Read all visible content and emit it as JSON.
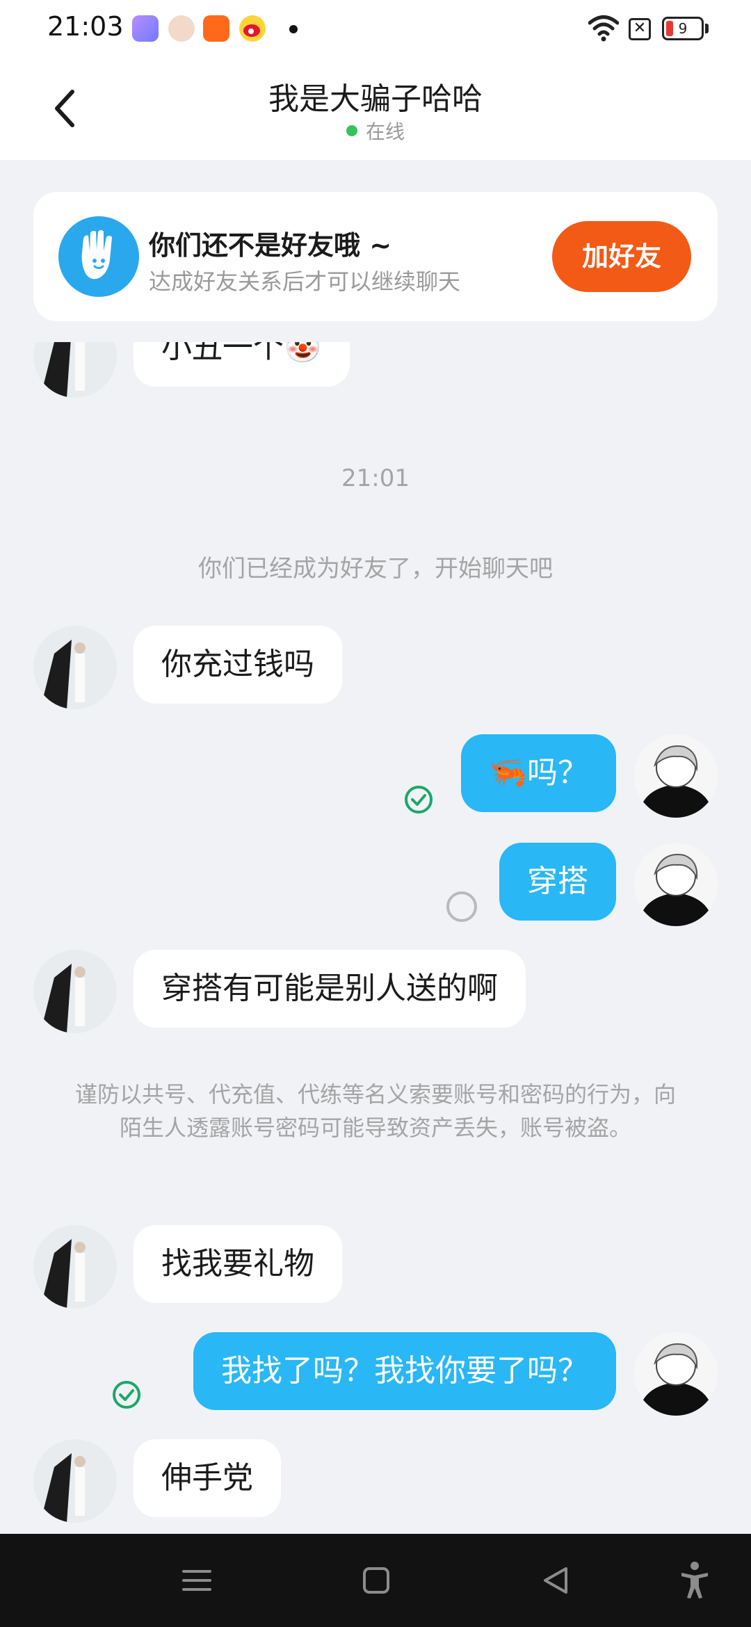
{
  "status_bar": {
    "time": "21:03",
    "battery_level": "9",
    "sim_glyph": "✕",
    "app_icons": [
      "app-icon-purple",
      "app-icon-avatar",
      "app-icon-orange",
      "weibo-icon"
    ],
    "colors": {
      "battery_low": "#e53935"
    }
  },
  "header": {
    "title": "我是大骗子哈哈",
    "status": "在线",
    "status_color": "#33c45a"
  },
  "banner": {
    "title": "你们还不是好友哦 ~",
    "subtitle": "达成好友关系后才可以继续聊天",
    "add_button": "加好友",
    "accent": "#f25a16"
  },
  "chat": {
    "partial_message": "小丑一个🤡",
    "timestamp": "21:01",
    "system_note": "你们已经成为好友了，开始聊天吧",
    "messages": [
      {
        "side": "in",
        "text": "你充过钱吗"
      },
      {
        "side": "out",
        "text": "🦐吗？",
        "status": "read"
      },
      {
        "side": "out",
        "text": "穿搭",
        "status": "pending"
      },
      {
        "side": "in",
        "text": "穿搭有可能是别人送的啊"
      },
      {
        "side": "in",
        "text": "找我要礼物"
      },
      {
        "side": "out",
        "text": "我找了吗？我找你要了吗？",
        "status": "read"
      },
      {
        "side": "in",
        "text": "伸手党"
      }
    ],
    "warning": "谨防以共号、代充值、代练等名义索要账号和密码的行为，向陌生人透露账号密码可能导致资产丢失，账号被盗。",
    "colors": {
      "outgoing_bubble": "#29b7f5",
      "read_check": "#19a86a"
    }
  },
  "nav_bar": {
    "buttons": [
      "menu-icon",
      "home-icon",
      "back-triangle-icon",
      "accessibility-icon"
    ]
  }
}
